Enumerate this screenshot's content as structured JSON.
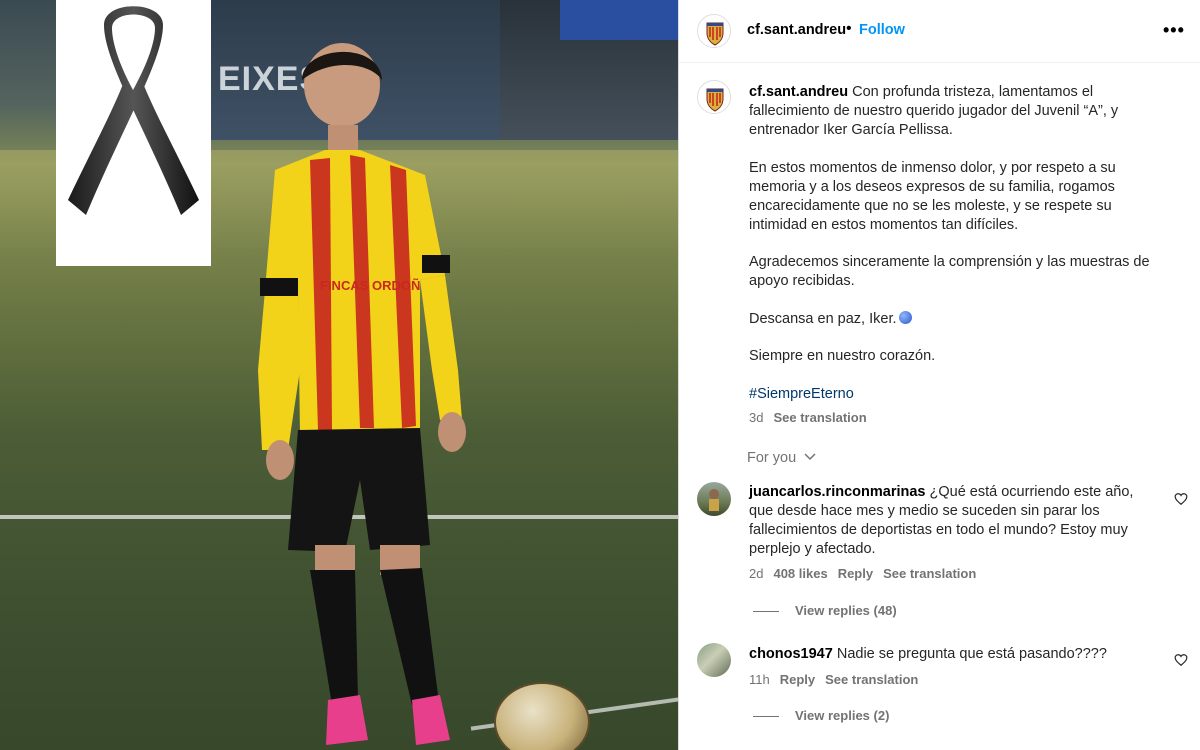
{
  "header": {
    "username": "cf.sant.andreu",
    "separator": "•",
    "follow_label": "Follow",
    "more_label": "•••"
  },
  "caption": {
    "username": "cf.sant.andreu",
    "paragraph1": "Con profunda tristeza, lamentamos el fallecimiento de nuestro querido jugador del Juvenil “A”, y entrenador Iker García Pellissa.",
    "paragraph2": "En estos momentos de inmenso dolor, y por respeto a su memoria y a los deseos expresos de su familia, rogamos encarecidamente que no se les moleste, y se respete su intimidad en estos momentos tan difíciles.",
    "paragraph3": "Agradecemos sinceramente la comprensión y las muestras de apoyo recibidas.",
    "paragraph4": "Descansa en paz, Iker.",
    "paragraph5": "Siempre en nuestro corazón.",
    "hashtag": "#SiempreEterno",
    "time": "3d",
    "see_translation": "See translation"
  },
  "for_you": {
    "label": "For you"
  },
  "comments": [
    {
      "username": "juancarlos.rinconmarinas",
      "text": "¿Qué está ocurriendo este año, que desde hace mes y medio se suceden sin parar los fallecimientos de deportistas en todo el mundo? Estoy muy perplejo y afectado.",
      "time": "2d",
      "likes": "408 likes",
      "reply": "Reply",
      "see_translation": "See translation",
      "view_replies": "View replies (48)"
    },
    {
      "username": "chonos1947",
      "text": "Nadie se pregunta que está pasando????",
      "time": "11h",
      "reply": "Reply",
      "see_translation": "See translation",
      "view_replies": "View replies (2)"
    }
  ],
  "media": {
    "sign_text": "EIXES",
    "jersey_sponsor": "FINCAS ORDOÑEZ"
  },
  "colors": {
    "follow": "#0095f6",
    "hashtag": "#00376b",
    "muted": "#737373",
    "jersey_yellow": "#f3d21a",
    "jersey_red": "#c8281e"
  },
  "icons": {
    "ribbon": "black-mourning-ribbon-icon",
    "more": "more-options-icon",
    "heart": "heart-outline-icon",
    "chevron": "chevron-down-icon",
    "globe": "globe-emoji-icon"
  }
}
